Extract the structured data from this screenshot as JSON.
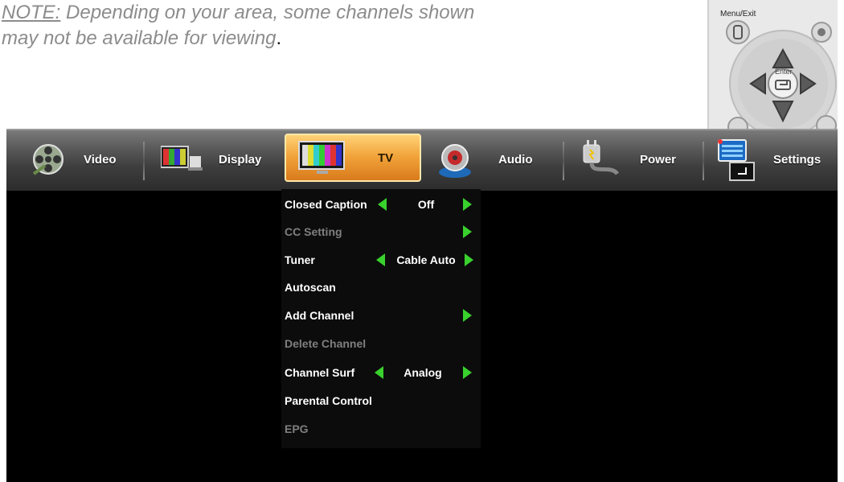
{
  "note": {
    "label": "NOTE:",
    "line1_rest": " Depending on your area, some channels shown",
    "line2": "may not be available for viewing",
    "period": "."
  },
  "remote": {
    "menu_exit_label": "Menu/Exit",
    "enter_label": "Enter"
  },
  "tabs": [
    {
      "label": "Video",
      "icon": "film-reel-icon",
      "active": false
    },
    {
      "label": "Display",
      "icon": "color-bars-display-icon",
      "active": false
    },
    {
      "label": "TV",
      "icon": "tv-monitor-icon",
      "active": true
    },
    {
      "label": "Audio",
      "icon": "speaker-icon",
      "active": false
    },
    {
      "label": "Power",
      "icon": "power-plug-icon",
      "active": false
    },
    {
      "label": "Settings",
      "icon": "settings-monitor-icon",
      "active": false
    }
  ],
  "menu": {
    "items": [
      {
        "label": "Closed Caption",
        "value": "Off",
        "enabled": true,
        "left_arrow": true,
        "right_arrow": true
      },
      {
        "label": "CC Setting",
        "value": "",
        "enabled": false,
        "left_arrow": false,
        "right_arrow": true
      },
      {
        "label": "Tuner",
        "value": "Cable Auto",
        "enabled": true,
        "left_arrow": true,
        "right_arrow": true
      },
      {
        "label": "Autoscan",
        "value": "",
        "enabled": true,
        "left_arrow": false,
        "right_arrow": false
      },
      {
        "label": "Add Channel",
        "value": "",
        "enabled": true,
        "left_arrow": false,
        "right_arrow": true
      },
      {
        "label": "Delete Channel",
        "value": "",
        "enabled": false,
        "left_arrow": false,
        "right_arrow": false
      },
      {
        "label": "Channel Surf",
        "value": "Analog",
        "enabled": true,
        "left_arrow": true,
        "right_arrow": true
      },
      {
        "label": "Parental Control",
        "value": "",
        "enabled": true,
        "left_arrow": false,
        "right_arrow": false
      },
      {
        "label": "EPG",
        "value": "",
        "enabled": false,
        "left_arrow": false,
        "right_arrow": false
      }
    ]
  },
  "colors": {
    "arrow": "#39d12d",
    "active_tab": "#f2a53c",
    "screen_bg": "#000000",
    "dim_text": "#7f7f7f"
  }
}
